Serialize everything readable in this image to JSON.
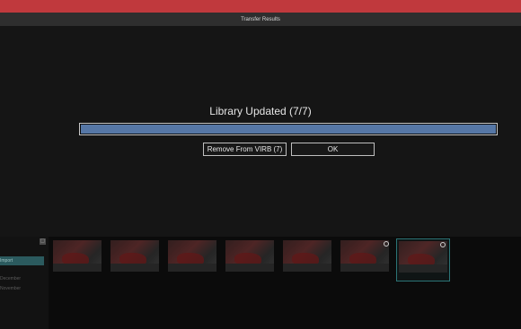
{
  "window": {
    "title": "Transfer Results",
    "accent_color": "#c0393d"
  },
  "dialog": {
    "status_title": "Library Updated (7/7)",
    "progress": {
      "current": 7,
      "total": 7,
      "fraction": 1.0,
      "color": "#5677a6"
    },
    "remove_button_label": "Remove From VIRB (7)",
    "ok_button_label": "OK"
  },
  "library": {
    "sidebar": {
      "header_button": "▢",
      "items": [
        {
          "label": "Import",
          "selected": true
        },
        {
          "label": "December"
        },
        {
          "label": "November"
        }
      ]
    },
    "thumbnails": [
      {
        "caption": "",
        "pin": false,
        "selected": false
      },
      {
        "caption": "",
        "pin": false,
        "selected": false
      },
      {
        "caption": "",
        "pin": false,
        "selected": false
      },
      {
        "caption": "",
        "pin": false,
        "selected": false
      },
      {
        "caption": "",
        "pin": false,
        "selected": false
      },
      {
        "caption": "",
        "pin": true,
        "selected": false
      },
      {
        "caption": "",
        "pin": true,
        "selected": true
      }
    ]
  }
}
